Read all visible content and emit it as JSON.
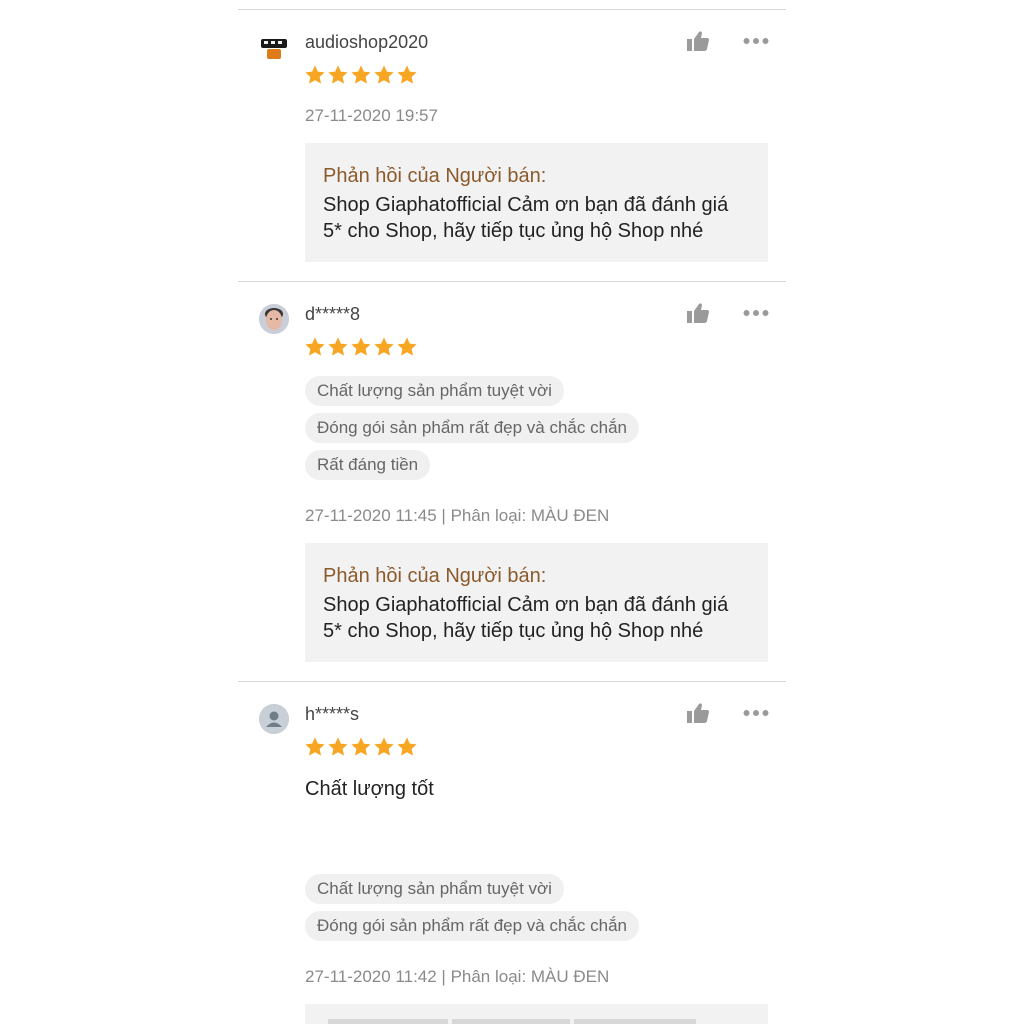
{
  "reviews": [
    {
      "username": "audioshop2020",
      "rating": 5,
      "meta": "27-11-2020 19:57",
      "reply_title": "Phản hồi của Người bán:",
      "reply_line1": "Shop Giaphatofficial Cảm ơn bạn đã đánh giá",
      "reply_line2": "5* cho Shop, hãy tiếp tục ủng hộ Shop nhé",
      "icons": {
        "like": "thumbs-up-icon",
        "more": "more-dots-icon",
        "star": "star-icon"
      }
    },
    {
      "username": "d*****8",
      "rating": 5,
      "tags": [
        "Chất lượng sản phẩm tuyệt vời",
        "Đóng gói sản phẩm rất đẹp và chắc chắn",
        "Rất đáng tiền"
      ],
      "meta": "27-11-2020 11:45 | Phân loại: MÀU ĐEN",
      "reply_title": "Phản hồi của Người bán:",
      "reply_line1": "Shop Giaphatofficial Cảm ơn bạn đã đánh giá",
      "reply_line2": "5* cho Shop, hãy tiếp tục ủng hộ Shop nhé"
    },
    {
      "username": "h*****s",
      "rating": 5,
      "comment": "Chất lượng tốt",
      "tags": [
        "Chất lượng sản phẩm tuyệt vời",
        "Đóng gói sản phẩm rất đẹp và chắc chắn"
      ],
      "meta": "27-11-2020 11:42 | Phân loại: MÀU ĐEN"
    }
  ],
  "colors": {
    "star": "#f6a623",
    "reply_title": "#8a5a2b",
    "icon": "#9a9a9a"
  }
}
